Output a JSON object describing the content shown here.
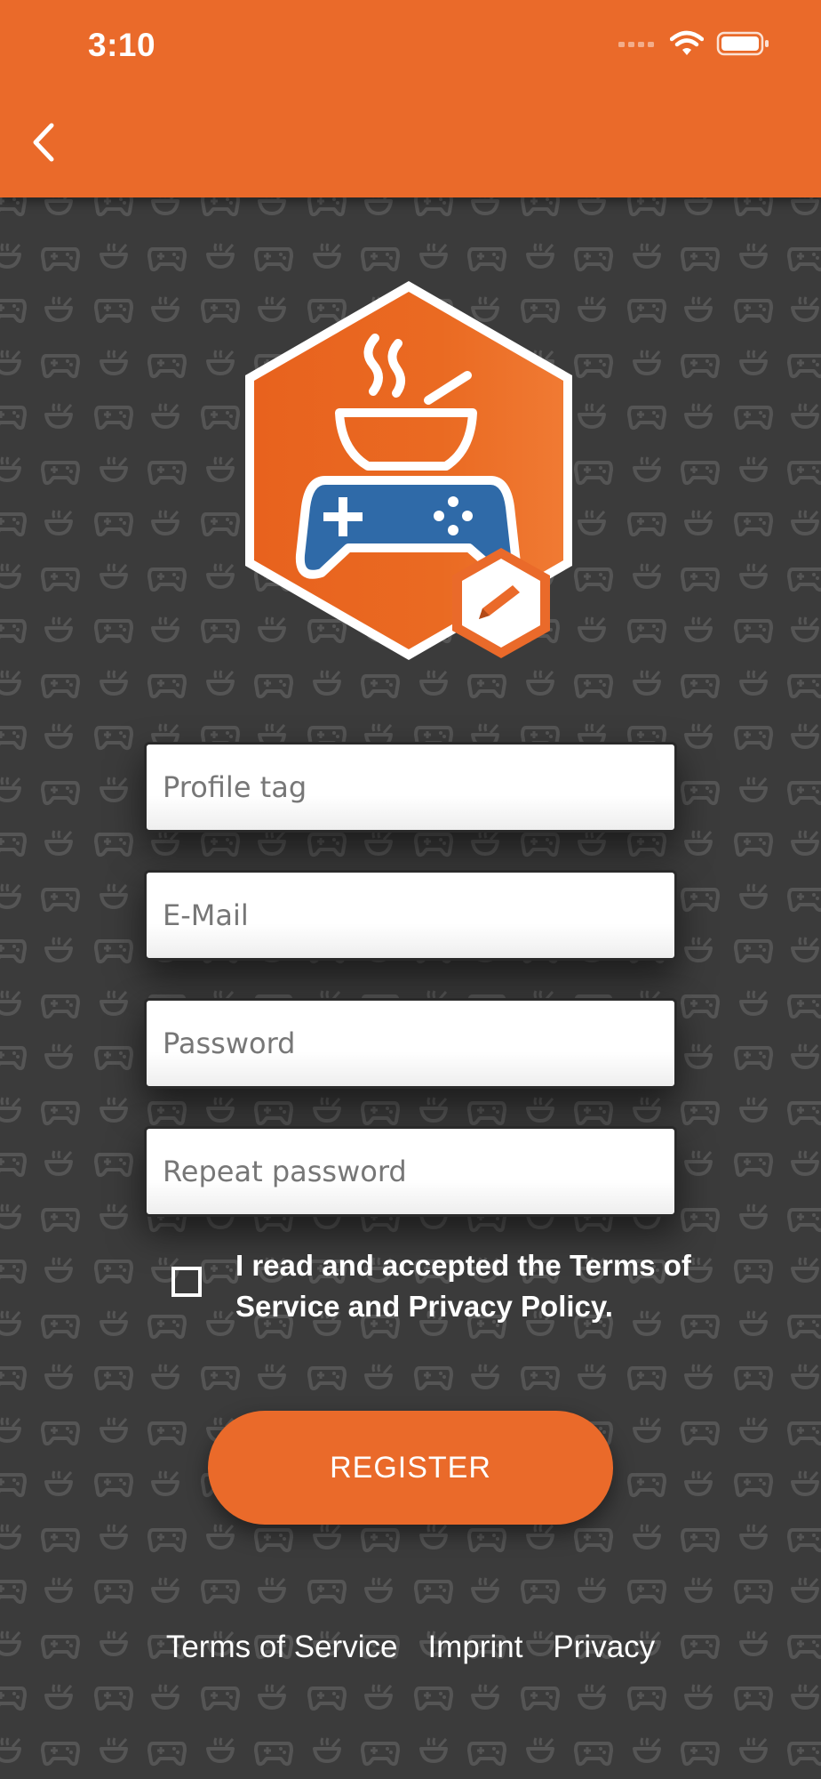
{
  "status_bar": {
    "time": "3:10",
    "icons": [
      "signal-icon",
      "wifi-icon",
      "battery-icon"
    ]
  },
  "header": {
    "back_icon": "chevron-left-icon",
    "color": "#ea6a2a"
  },
  "avatar": {
    "icon": "bowl-gamepad-logo",
    "edit_icon": "pencil-icon"
  },
  "form": {
    "profile_tag_placeholder": "Profile tag",
    "email_placeholder": "E-Mail",
    "password_placeholder": "Password",
    "repeat_password_placeholder": "Repeat password"
  },
  "terms": {
    "checked": false,
    "text": "I read and accepted the Terms of Service and Privacy Policy."
  },
  "register_label": "REGISTER",
  "footer": {
    "terms_of_service": "Terms of Service",
    "imprint": "Imprint",
    "privacy": "Privacy"
  },
  "colors": {
    "accent": "#ea6a2a",
    "background": "#3b3b3b",
    "pattern": "#555555",
    "gamepad": "#2f6aa8"
  }
}
